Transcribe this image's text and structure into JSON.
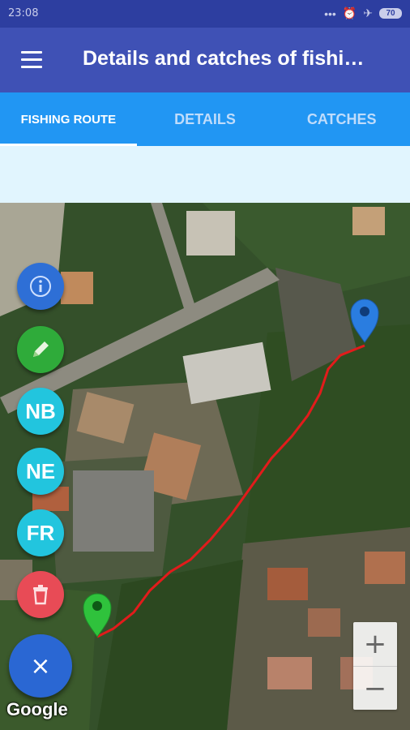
{
  "status_bar": {
    "time": "23:08",
    "battery": "70"
  },
  "app_bar": {
    "title": "Details and catches of fishi…"
  },
  "tabs": [
    {
      "label": "FISHING ROUTE",
      "active": true
    },
    {
      "label": "DETAILS",
      "active": false
    },
    {
      "label": "CATCHES",
      "active": false
    }
  ],
  "fabs": {
    "nb": "NB",
    "ne": "NE",
    "fr": "FR",
    "close": "×"
  },
  "zoom": {
    "in": "+",
    "out": "−"
  },
  "map": {
    "attribution": "Google"
  },
  "colors": {
    "status": "#2d3ea0",
    "app_bar": "#3f51b5",
    "tabs": "#2196f3",
    "route": "#e21b1b",
    "start_marker": "#2fc23c",
    "end_marker": "#2a7de0"
  }
}
